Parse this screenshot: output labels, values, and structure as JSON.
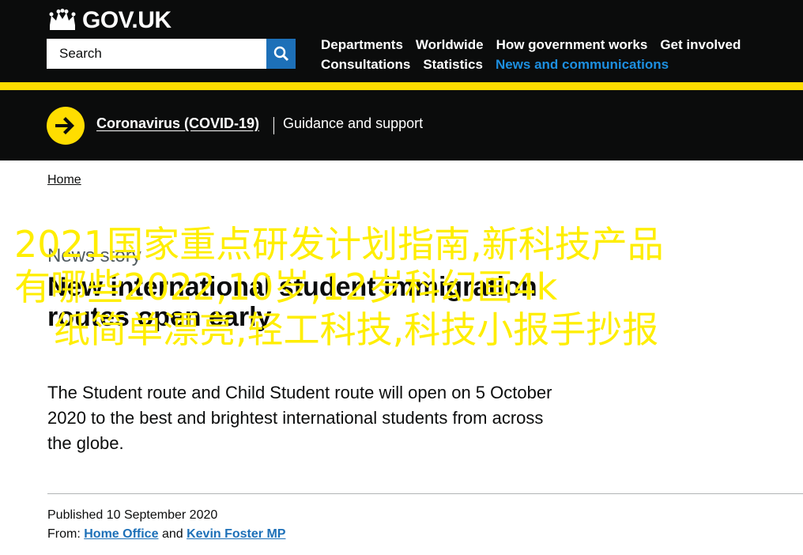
{
  "header": {
    "logo_text": "GOV.UK",
    "search_placeholder": "Search",
    "nav": [
      {
        "label": "Departments"
      },
      {
        "label": "Worldwide"
      },
      {
        "label": "How government works"
      },
      {
        "label": "Get involved"
      },
      {
        "label": "Consultations"
      },
      {
        "label": "Statistics"
      },
      {
        "label": "News and communications",
        "active": true
      }
    ]
  },
  "banner": {
    "link": "Coronavirus (COVID-19)",
    "subtitle": "Guidance and support"
  },
  "breadcrumb": {
    "home": "Home"
  },
  "article": {
    "caption": "News story",
    "title": "New international student immigration routes open early",
    "summary": "The Student route and Child Student route will open on 5 October 2020 to the best and brightest international students from across the globe.",
    "published": "Published 10 September 2020",
    "from_label": "From:",
    "from_and": "and",
    "from_1": "Home Office",
    "from_2": "Kevin Foster MP"
  },
  "overlay": {
    "line1": "2021国家重点研发计划指南,新科技产品",
    "line2": "有哪些2022,10岁,12岁科幻画4k",
    "line3": "纸简单漂亮,轻工科技,科技小报手抄报"
  },
  "colors": {
    "header_bg": "#0b0c0c",
    "accent_yellow": "#ffdd00",
    "link_blue": "#1d70b8",
    "overlay_yellow": "#ffee00"
  }
}
